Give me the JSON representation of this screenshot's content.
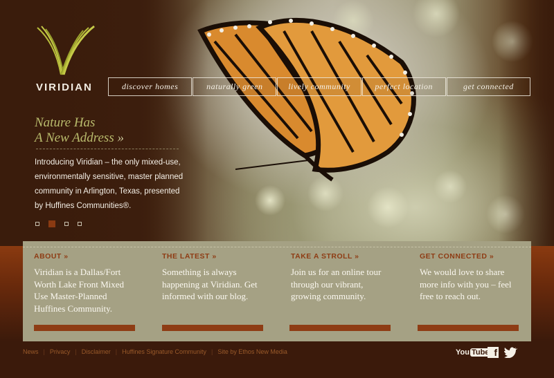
{
  "brand": {
    "name": "VIRIDIAN"
  },
  "nav": [
    {
      "label": "discover homes"
    },
    {
      "label": "naturally green"
    },
    {
      "label": "lively community"
    },
    {
      "label": "perfect location"
    },
    {
      "label": "get connected"
    }
  ],
  "hero": {
    "headline_line1": "Nature Has",
    "headline_line2": "A New Address",
    "headline_arrow": "»",
    "intro": "Introducing Viridian – the only mixed-use, environmentally sensitive, master planned community in Arlington, Texas, presented by Huffines Communities®.",
    "slide_count": 4,
    "active_slide": 2
  },
  "columns": [
    {
      "title": "ABOUT »",
      "body": "Viridian is a Dallas/Fort Worth Lake Front Mixed Use Master-Planned Huffines Community."
    },
    {
      "title": "THE LATEST »",
      "body": "Something is always happening at Viridian. Get informed with our blog."
    },
    {
      "title": "TAKE A STROLL »",
      "body": "Join us for an online tour through our vibrant, growing community."
    },
    {
      "title": "GET CONNECTED »",
      "body": "We would love to share more info with you – feel free to reach out."
    }
  ],
  "footer": {
    "links": [
      "News",
      "Privacy",
      "Disclaimer",
      "Huffines Signature Community",
      "Site by Ethos New Media"
    ],
    "separator": "|"
  },
  "social": {
    "youtube_you": "You",
    "youtube_tube": "Tube",
    "facebook": "f"
  },
  "colors": {
    "accent": "#8e3c14",
    "headline": "#b9bb6c",
    "panel": "#a5a184",
    "background": "#3b1a0b"
  }
}
